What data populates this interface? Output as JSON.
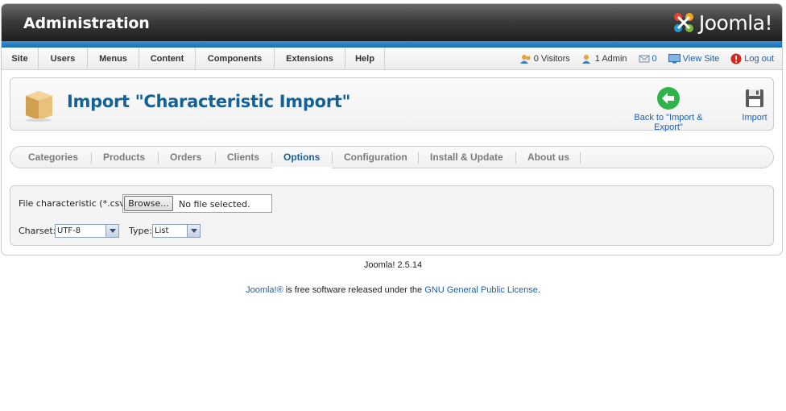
{
  "header": {
    "title": "Administration",
    "logo_text": "Joomla!",
    "logo_mark": "®"
  },
  "menu": {
    "items": [
      "Site",
      "Users",
      "Menus",
      "Content",
      "Components",
      "Extensions",
      "Help"
    ]
  },
  "status": {
    "visitors": "0 Visitors",
    "admins": "1 Admin",
    "messages": "0",
    "view_site": "View Site",
    "logout": "Log out"
  },
  "toolbar": {
    "title": "Import \"Characteristic Import\"",
    "back_label": "Back to \"Import & Export\"",
    "import_label": "Import"
  },
  "subnav": {
    "items": [
      "Categories",
      "Products",
      "Orders",
      "Clients",
      "Options",
      "Configuration",
      "Install & Update",
      "About us"
    ],
    "active": "Options"
  },
  "form": {
    "file_label": "File characteristic (*.csv):",
    "browse_label": "Browse...",
    "file_status": "No file selected.",
    "charset_label": "Charset:",
    "charset_value": "UTF-8",
    "type_label": "Type:",
    "type_value": "List"
  },
  "footer": {
    "version": "Joomla! 2.5.14",
    "license_brand": "Joomla!®",
    "license_mid": " is free software released under the ",
    "license_link": "GNU General Public License",
    "license_end": "."
  },
  "colors": {
    "title_blue": "#146295",
    "link_blue": "#1f5fa6",
    "band_blue": "#1a6fb0",
    "back_green": "#2fb34a"
  }
}
